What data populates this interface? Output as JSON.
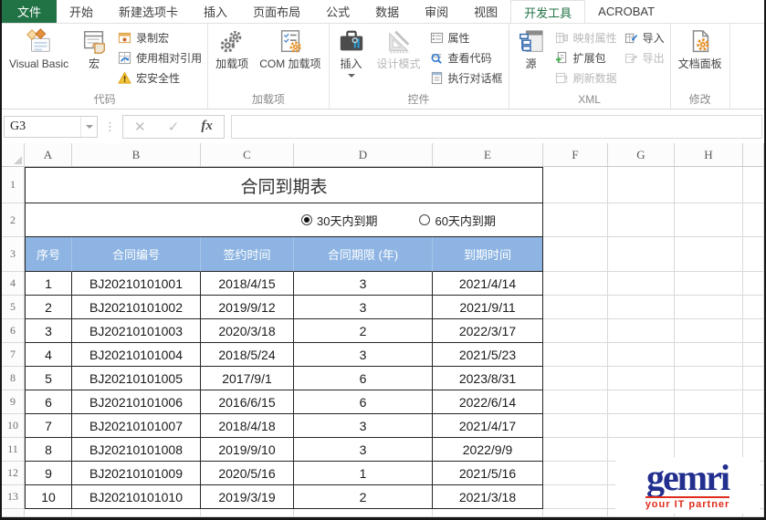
{
  "tabs": [
    {
      "label": "文件",
      "file": true
    },
    {
      "label": "开始"
    },
    {
      "label": "新建选项卡"
    },
    {
      "label": "插入"
    },
    {
      "label": "页面布局"
    },
    {
      "label": "公式"
    },
    {
      "label": "数据"
    },
    {
      "label": "审阅"
    },
    {
      "label": "视图"
    },
    {
      "label": "开发工具",
      "active": true
    },
    {
      "label": "ACROBAT"
    }
  ],
  "ribbon": {
    "code": {
      "label": "代码",
      "vb": "Visual Basic",
      "macros": "宏",
      "record": "录制宏",
      "relative": "使用相对引用",
      "security": "宏安全性"
    },
    "addins": {
      "label": "加载项",
      "addins": "加载项",
      "com": "COM 加载项"
    },
    "controls": {
      "label": "控件",
      "insert": "插入",
      "design": "设计模式",
      "props": "属性",
      "viewcode": "查看代码",
      "rundialog": "执行对话框"
    },
    "xml": {
      "label": "XML",
      "source": "源",
      "map": "映射属性",
      "expansion": "扩展包",
      "refresh": "刷新数据",
      "import": "导入",
      "export": "导出"
    },
    "modify": {
      "label": "修改",
      "docpanel": "文档面板"
    }
  },
  "formula_bar": {
    "name_box": "G3",
    "cancel": "✕",
    "enter": "✓",
    "fx": "fx",
    "value": ""
  },
  "grid": {
    "columns": [
      "A",
      "B",
      "C",
      "D",
      "E",
      "F",
      "G",
      "H"
    ]
  },
  "sheet": {
    "title": "合同到期表",
    "radios": [
      {
        "label": "30天内到期",
        "checked": true
      },
      {
        "label": "60天内到期",
        "checked": false
      }
    ],
    "header": [
      "序号",
      "合同编号",
      "签约时间",
      "合同期限 (年)",
      "到期时间"
    ],
    "rows": [
      [
        "1",
        "BJ20210101001",
        "2018/4/15",
        "3",
        "2021/4/14"
      ],
      [
        "2",
        "BJ20210101002",
        "2019/9/12",
        "3",
        "2021/9/11"
      ],
      [
        "3",
        "BJ20210101003",
        "2020/3/18",
        "2",
        "2022/3/17"
      ],
      [
        "4",
        "BJ20210101004",
        "2018/5/24",
        "3",
        "2021/5/23"
      ],
      [
        "5",
        "BJ20210101005",
        "2017/9/1",
        "6",
        "2023/8/31"
      ],
      [
        "6",
        "BJ20210101006",
        "2016/6/15",
        "6",
        "2022/6/14"
      ],
      [
        "7",
        "BJ20210101007",
        "2018/4/18",
        "3",
        "2021/4/17"
      ],
      [
        "8",
        "BJ20210101008",
        "2019/9/10",
        "3",
        "2022/9/9"
      ],
      [
        "9",
        "BJ20210101009",
        "2020/5/16",
        "1",
        "2021/5/16"
      ],
      [
        "10",
        "BJ20210101010",
        "2019/3/19",
        "2",
        "2021/3/18"
      ]
    ]
  },
  "logo": {
    "word": "gemri",
    "tagline": "your IT partner"
  },
  "colors": {
    "excel_green": "#217346",
    "header_blue": "#8DB4E2",
    "logo_blue": "#232f8f",
    "logo_red": "#e12c1c"
  }
}
